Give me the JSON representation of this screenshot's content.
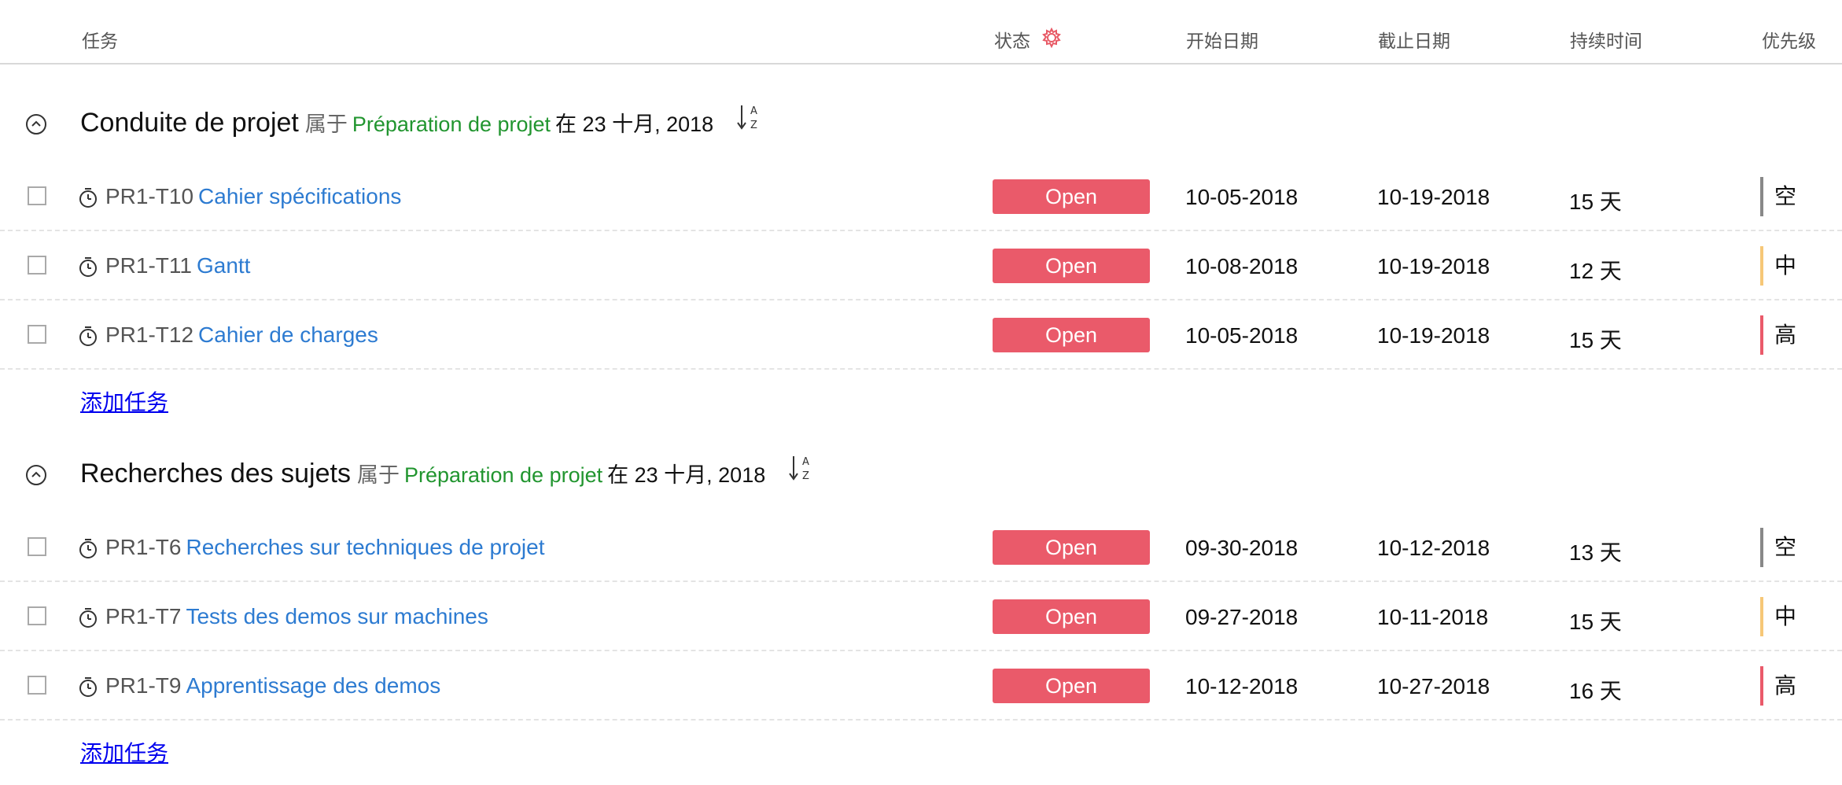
{
  "columns": {
    "task": "任务",
    "status": "状态",
    "start": "开始日期",
    "due": "截止日期",
    "duration": "持续时间",
    "priority": "优先级"
  },
  "status_settings_icon": "gear-icon",
  "colors": {
    "status_open": "#ea5a6a",
    "link": "#2d7bd1",
    "parent_link": "#21952f",
    "priority_none": "#888888",
    "priority_medium": "#f6c777",
    "priority_high": "#ea5a6a"
  },
  "groups": [
    {
      "title": "Conduite de projet",
      "belongs": "属于",
      "parent": "Préparation de projet",
      "date": "在 23 十月, 2018",
      "add_label": "添加任务",
      "tasks": [
        {
          "id": "PR1-T10",
          "name": "Cahier spécifications",
          "status": "Open",
          "start": "10-05-2018",
          "due": "10-19-2018",
          "duration": "15 天",
          "priority": "空",
          "priority_color": "#888888"
        },
        {
          "id": "PR1-T11",
          "name": "Gantt",
          "status": "Open",
          "start": "10-08-2018",
          "due": "10-19-2018",
          "duration": "12 天",
          "priority": "中",
          "priority_color": "#f6c777"
        },
        {
          "id": "PR1-T12",
          "name": "Cahier de charges",
          "status": "Open",
          "start": "10-05-2018",
          "due": "10-19-2018",
          "duration": "15 天",
          "priority": "高",
          "priority_color": "#ea5a6a"
        }
      ]
    },
    {
      "title": "Recherches des sujets",
      "belongs": "属于",
      "parent": "Préparation de projet",
      "date": "在 23 十月, 2018",
      "add_label": "添加任务",
      "tasks": [
        {
          "id": "PR1-T6",
          "name": "Recherches sur techniques de projet",
          "status": "Open",
          "start": "09-30-2018",
          "due": "10-12-2018",
          "duration": "13 天",
          "priority": "空",
          "priority_color": "#888888"
        },
        {
          "id": "PR1-T7",
          "name": "Tests des demos sur machines",
          "status": "Open",
          "start": "09-27-2018",
          "due": "10-11-2018",
          "duration": "15 天",
          "priority": "中",
          "priority_color": "#f6c777"
        },
        {
          "id": "PR1-T9",
          "name": "Apprentissage des demos",
          "status": "Open",
          "start": "10-12-2018",
          "due": "10-27-2018",
          "duration": "16 天",
          "priority": "高",
          "priority_color": "#ea5a6a"
        }
      ]
    }
  ]
}
